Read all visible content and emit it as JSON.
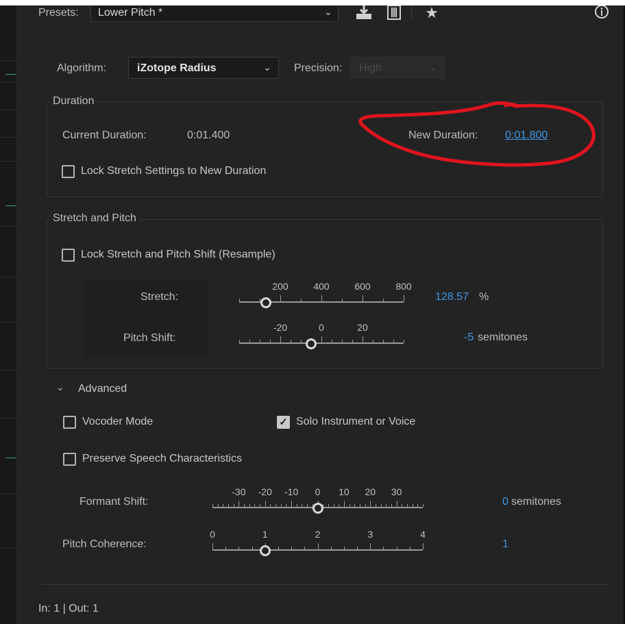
{
  "presets": {
    "label": "Presets:",
    "value": "Lower Pitch *"
  },
  "toolbar": {
    "save_icon": "download-icon",
    "list_icon": "list-icon",
    "fav_icon": "star-icon",
    "info_icon": "info-icon"
  },
  "algorithm": {
    "label": "Algorithm:",
    "value": "iZotope Radius"
  },
  "precision": {
    "label": "Precision:",
    "value": "High"
  },
  "duration": {
    "title": "Duration",
    "current_label": "Current Duration:",
    "current_value": "0:01.400",
    "new_label": "New Duration:",
    "new_value": "0:01.800",
    "lock_label": "Lock Stretch Settings to New Duration",
    "lock_checked": false
  },
  "stretch_pitch": {
    "title": "Stretch and Pitch",
    "lock_label": "Lock Stretch and Pitch Shift (Resample)",
    "lock_checked": false,
    "stretch": {
      "label": "Stretch:",
      "ticks": [
        "200",
        "400",
        "600",
        "800"
      ],
      "value": "128.57",
      "unit": "%",
      "range": [
        0,
        800
      ],
      "current": 128.57
    },
    "pitch": {
      "label": "Pitch Shift:",
      "ticks": [
        "-20",
        "0",
        "20"
      ],
      "value": "-5",
      "unit": "semitones",
      "range": [
        -40,
        40
      ],
      "current": -5
    }
  },
  "advanced": {
    "title": "Advanced",
    "vocoder_label": "Vocoder Mode",
    "vocoder_checked": false,
    "solo_label": "Solo Instrument or Voice",
    "solo_checked": true,
    "preserve_label": "Preserve Speech Characteristics",
    "preserve_checked": false,
    "formant": {
      "label": "Formant Shift:",
      "ticks": [
        "-30",
        "-20",
        "-10",
        "0",
        "10",
        "20",
        "30"
      ],
      "value": "0",
      "unit": "semitones",
      "range": [
        -40,
        40
      ],
      "current": 0
    },
    "coherence": {
      "label": "Pitch Coherence:",
      "ticks": [
        "0",
        "1",
        "2",
        "3",
        "4"
      ],
      "value": "1",
      "range": [
        0,
        4
      ],
      "current": 1
    }
  },
  "footer": {
    "io_text": "In: 1 | Out: 1"
  },
  "colors": {
    "accent": "#3f98e8",
    "annotation": "#e0141e",
    "panel_bg": "#232323"
  }
}
